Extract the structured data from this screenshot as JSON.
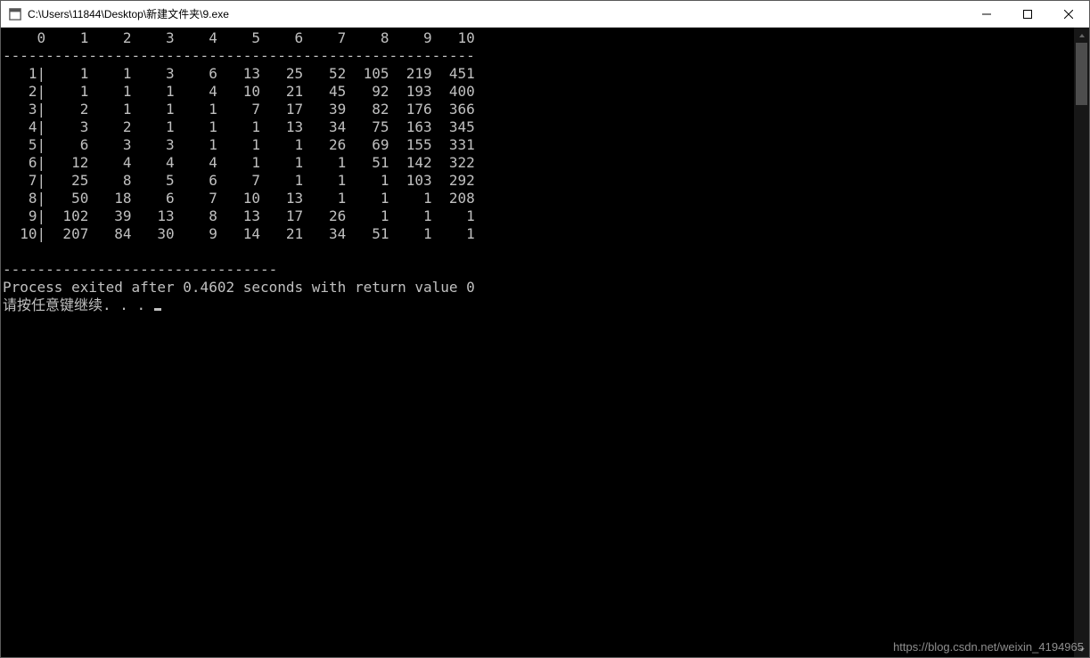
{
  "titlebar": {
    "title": "C:\\Users\\11844\\Desktop\\新建文件夹\\9.exe"
  },
  "chart_data": {
    "type": "table",
    "column_headers": [
      "0",
      "1",
      "2",
      "3",
      "4",
      "5",
      "6",
      "7",
      "8",
      "9",
      "10"
    ],
    "row_headers": [
      "1",
      "2",
      "3",
      "4",
      "5",
      "6",
      "7",
      "8",
      "9",
      "10"
    ],
    "rows": [
      [
        1,
        1,
        3,
        6,
        13,
        25,
        52,
        105,
        219,
        451
      ],
      [
        1,
        1,
        1,
        4,
        10,
        21,
        45,
        92,
        193,
        400
      ],
      [
        2,
        1,
        1,
        1,
        7,
        17,
        39,
        82,
        176,
        366
      ],
      [
        3,
        2,
        1,
        1,
        1,
        13,
        34,
        75,
        163,
        345
      ],
      [
        6,
        3,
        3,
        1,
        1,
        1,
        26,
        69,
        155,
        331
      ],
      [
        12,
        4,
        4,
        4,
        1,
        1,
        1,
        51,
        142,
        322
      ],
      [
        25,
        8,
        5,
        6,
        7,
        1,
        1,
        1,
        103,
        292
      ],
      [
        50,
        18,
        6,
        7,
        10,
        13,
        1,
        1,
        1,
        208
      ],
      [
        102,
        39,
        13,
        8,
        13,
        17,
        26,
        1,
        1,
        1
      ],
      [
        207,
        84,
        30,
        9,
        14,
        21,
        34,
        51,
        1,
        1
      ]
    ]
  },
  "console": {
    "header_row": "    0    1    2    3    4    5    6    7    8    9   10",
    "separator1": "-------------------------------------------------------",
    "data_rows": [
      "   1|    1    1    3    6   13   25   52  105  219  451",
      "   2|    1    1    1    4   10   21   45   92  193  400",
      "   3|    2    1    1    1    7   17   39   82  176  366",
      "   4|    3    2    1    1    1   13   34   75  163  345",
      "   5|    6    3    3    1    1    1   26   69  155  331",
      "   6|   12    4    4    4    1    1    1   51  142  322",
      "   7|   25    8    5    6    7    1    1    1  103  292",
      "   8|   50   18    6    7   10   13    1    1    1  208",
      "   9|  102   39   13    8   13   17   26    1    1    1",
      "  10|  207   84   30    9   14   21   34   51    1    1"
    ],
    "separator2": "--------------------------------",
    "exit_msg": "Process exited after 0.4602 seconds with return value 0",
    "continue_msg": "请按任意键继续. . . "
  },
  "watermark": "https://blog.csdn.net/weixin_4194965"
}
